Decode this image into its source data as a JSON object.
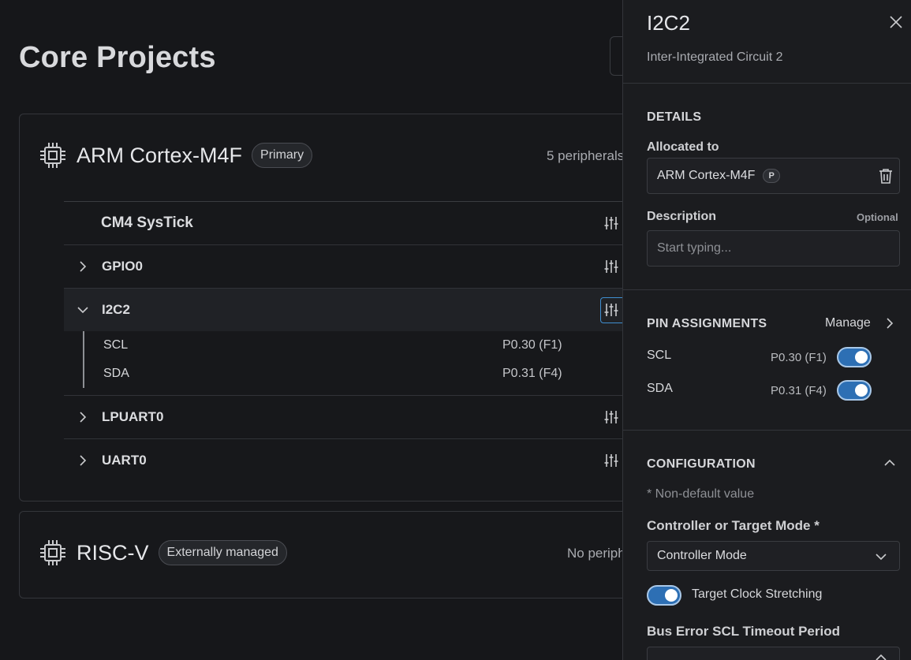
{
  "main": {
    "title": "Core Projects",
    "cards": [
      {
        "name": "ARM Cortex-M4F",
        "badge": "Primary",
        "count": "5 peripherals",
        "peripherals": [
          {
            "label": "CM4 SysTick",
            "expandable": false
          },
          {
            "label": "GPIO0",
            "expandable": true
          },
          {
            "label": "I2C2",
            "expandable": true,
            "expanded": true,
            "signals": [
              {
                "name": "SCL",
                "value": "P0.30 (F1)"
              },
              {
                "name": "SDA",
                "value": "P0.31 (F4)"
              }
            ]
          },
          {
            "label": "LPUART0",
            "expandable": true
          },
          {
            "label": "UART0",
            "expandable": true
          }
        ]
      },
      {
        "name": "RISC-V",
        "badge": "Externally managed",
        "count": "No periph"
      }
    ]
  },
  "panel": {
    "title": "I2C2",
    "subtitle": "Inter-Integrated Circuit 2",
    "details": {
      "heading": "DETAILS",
      "allocated_label": "Allocated to",
      "allocated_value": "ARM Cortex-M4F",
      "allocated_badge": "P",
      "description_label": "Description",
      "optional": "Optional",
      "description_placeholder": "Start typing..."
    },
    "pins": {
      "heading": "PIN ASSIGNMENTS",
      "manage": "Manage",
      "items": [
        {
          "name": "SCL",
          "value": "P0.30 (F1)",
          "enabled": true
        },
        {
          "name": "SDA",
          "value": "P0.31 (F4)",
          "enabled": true
        }
      ]
    },
    "config": {
      "heading": "CONFIGURATION",
      "note": "* Non-default value",
      "mode_label": "Controller or Target Mode *",
      "mode_value": "Controller Mode",
      "stretch_label": "Target Clock Stretching",
      "stretch_enabled": true,
      "bus_label": "Bus Error SCL Timeout Period"
    }
  },
  "colors": {
    "background": "#16171a",
    "panel": "#1b1c1f",
    "accent": "#2d6fb4",
    "focus": "#3f8fd1"
  }
}
